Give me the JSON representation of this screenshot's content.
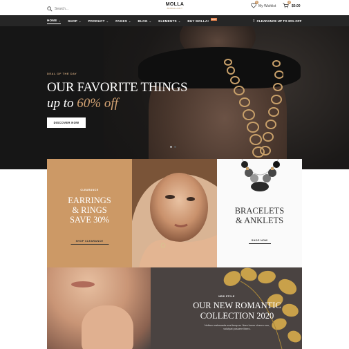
{
  "header": {
    "search_placeholder": "Search...",
    "logo_main": "MOLLA",
    "logo_sub": "JEWELLERY",
    "wishlist_label": "My Wishlist",
    "wishlist_count": "0",
    "cart_count": "0",
    "cart_total": "$0.00"
  },
  "nav": {
    "items": [
      {
        "label": "HOME"
      },
      {
        "label": "SHOP"
      },
      {
        "label": "PRODUCT"
      },
      {
        "label": "PAGES"
      },
      {
        "label": "BLOG"
      },
      {
        "label": "ELEMENTS"
      },
      {
        "label": "BUY MOLLA!"
      }
    ],
    "hot_badge": "HOT",
    "clearance": "CLEARANCE UP TO 30% OFF"
  },
  "hero": {
    "eyebrow": "DEAL OF THE DAY",
    "title": "OUR FAVORITE THINGS",
    "subtitle_prefix": "up to ",
    "subtitle_highlight": "60% off",
    "button": "DISCOVER NOW"
  },
  "banners": [
    {
      "eyebrow": "CLEARANCE",
      "title_line1": "EARRINGS",
      "title_line2": "& RINGS",
      "title_line3": "SAVE 30%",
      "link": "SHOP CLEARANCE"
    },
    {
      "title_line1": "BRACELETS",
      "title_line2": "& ANKLETS",
      "link": "SHOP NOW"
    }
  ],
  "promo": {
    "eyebrow": "NEW STYLE",
    "title_line1": "OUR NEW ROMANTIC",
    "title_line2": "COLLECTION 2020",
    "text": "Nullam malesuada erat tempus. Nam lorem viverra non, volutpat posuere libero."
  },
  "colors": {
    "accent": "#cc9966",
    "nav_bg": "#262626",
    "promo_bg": "#4a4341"
  }
}
